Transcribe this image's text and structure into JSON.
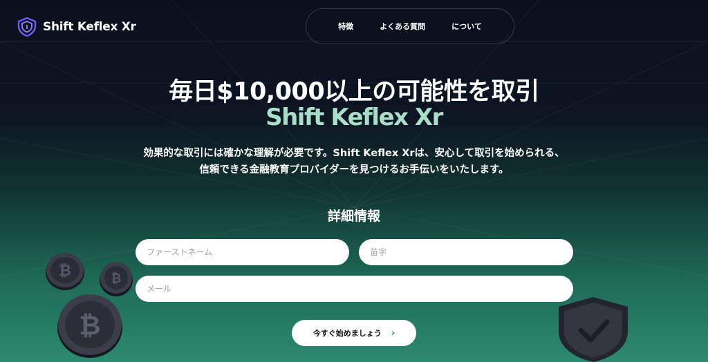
{
  "header": {
    "brand": "Shift Keflex Xr",
    "nav": [
      {
        "label": "特徴"
      },
      {
        "label": "よくある質問"
      },
      {
        "label": "について"
      }
    ]
  },
  "hero": {
    "title": "毎日$10,000以上の可能性を取引",
    "brand": "Shift Keflex Xr",
    "description_line1": "効果的な取引には確かな理解が必要です。Shift Keflex Xrは、安心して取引を始められる、",
    "description_line2": "信頼できる金融教育プロバイダーを見つけるお手伝いをいたします。"
  },
  "form": {
    "title": "詳細情報",
    "first_name_placeholder": "ファーストネーム",
    "last_name_placeholder": "苗字",
    "email_placeholder": "メール",
    "submit_label": "今すぐ始めましょう",
    "submit_arrow": "›"
  },
  "icons": {
    "logo": "shield-logo-icon",
    "coins": "bitcoin-coin-icon",
    "shield": "shield-check-icon",
    "arrow": "chevron-right-icon"
  },
  "colors": {
    "background_top": "#0b0f1c",
    "background_bottom": "#2c8a70",
    "brand_accent": "#a9dfc9",
    "logo_accent": "#6b5cff"
  }
}
